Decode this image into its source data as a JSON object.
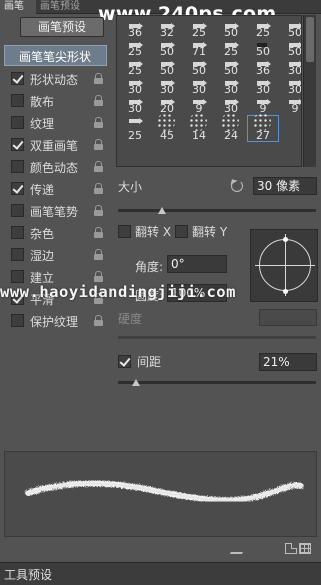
{
  "tabs": [
    "画笔",
    "画笔预设"
  ],
  "watermark_top": "www.240ps.com",
  "watermark_mid": "www.haoyidandingjiji.com",
  "preset_button": "画笔预设",
  "options": {
    "header": "画笔笔尖形状",
    "items": [
      {
        "label": "形状动态",
        "checked": true
      },
      {
        "label": "散布",
        "checked": false
      },
      {
        "label": "纹理",
        "checked": false
      },
      {
        "label": "双重画笔",
        "checked": true
      },
      {
        "label": "颜色动态",
        "checked": false
      },
      {
        "label": "传递",
        "checked": true
      },
      {
        "label": "画笔笔势",
        "checked": false
      },
      {
        "label": "杂色",
        "checked": false
      },
      {
        "label": "湿边",
        "checked": false
      },
      {
        "label": "建立",
        "checked": false
      },
      {
        "label": "平滑",
        "checked": true
      },
      {
        "label": "保护纹理",
        "checked": false
      }
    ]
  },
  "brush_grid": {
    "rows": [
      [
        "36",
        "32",
        "25",
        "50",
        "25",
        "50"
      ],
      [
        "25",
        "50",
        "71",
        "25",
        "50",
        "50"
      ],
      [
        "25",
        "50",
        "50",
        "50",
        "36",
        "30"
      ],
      [
        "30",
        "30",
        "30",
        "30",
        "30",
        "30"
      ],
      [
        "30",
        "20",
        "9",
        "30",
        "9",
        "9"
      ],
      [
        "25",
        "45",
        "14",
        "24",
        "27",
        ""
      ]
    ],
    "selected": "27"
  },
  "size": {
    "label": "大小",
    "value": "30 像素",
    "slider_fraction": 0.22
  },
  "flip": {
    "x_label": "翻转 X",
    "y_label": "翻转 Y"
  },
  "angle": {
    "label": "角度:",
    "value": "0°"
  },
  "roundness": {
    "label": "圆度:",
    "value": "100%"
  },
  "hardness": {
    "label": "硬度"
  },
  "spacing": {
    "label": "间距",
    "value": "21%",
    "checked": true,
    "slider_fraction": 0.09
  },
  "footer_tab": "工具预设"
}
